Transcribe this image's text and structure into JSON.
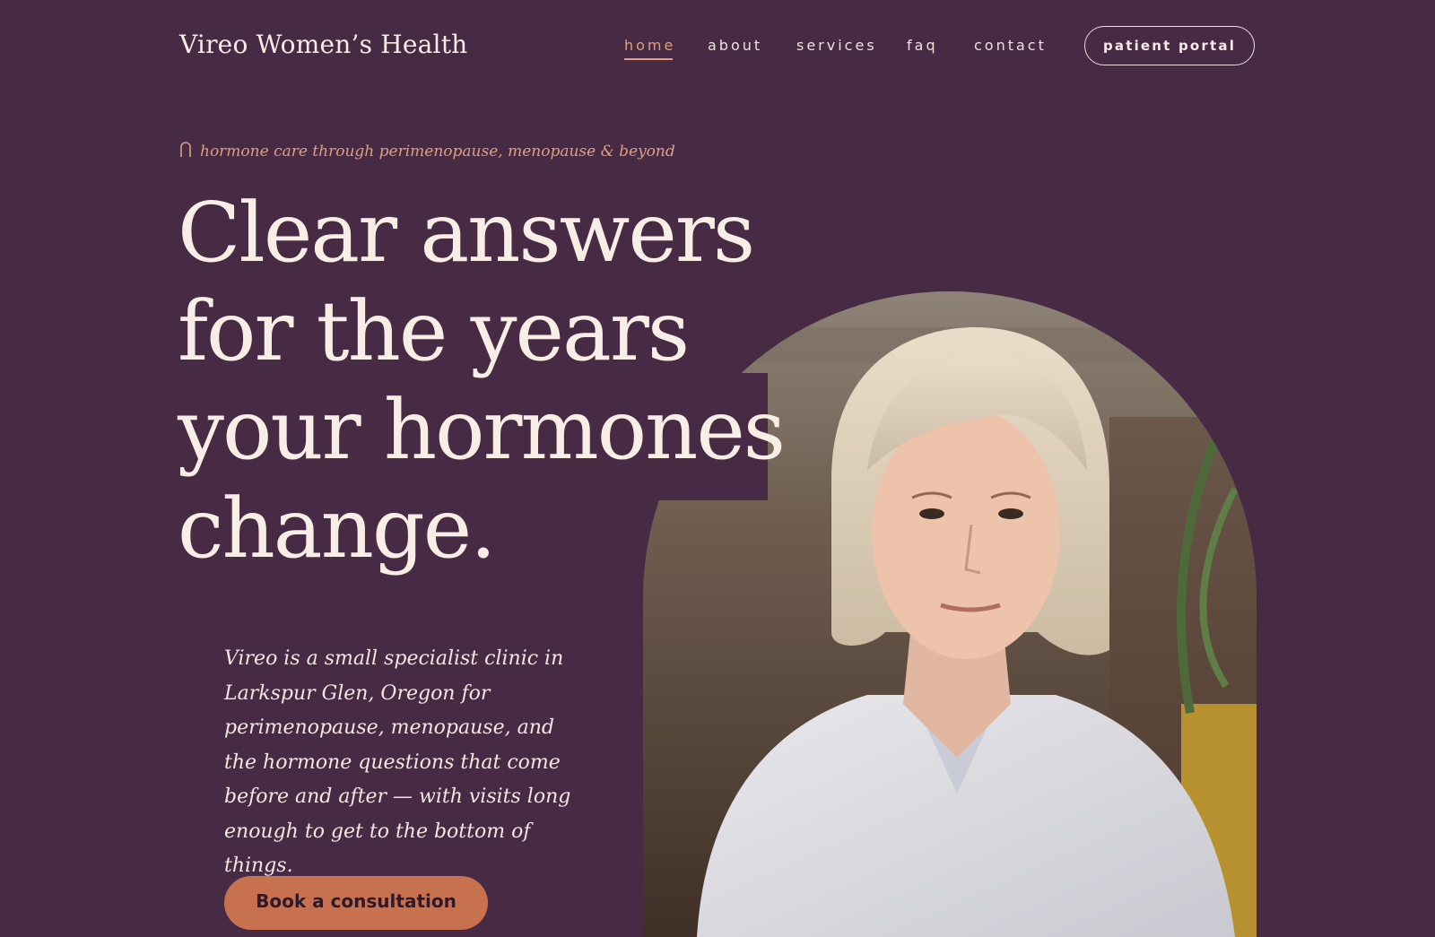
{
  "header": {
    "logo": "Vireo Women’s Health",
    "nav": [
      {
        "label": "home",
        "active": true
      },
      {
        "label": "about",
        "active": false
      },
      {
        "label": "services",
        "active": false
      },
      {
        "label": "faq",
        "active": false
      },
      {
        "label": "contact",
        "active": false
      }
    ],
    "portal_label": "patient portal"
  },
  "hero": {
    "eyebrow_icon": "arch-icon",
    "eyebrow": "hormone care through perimenopause, menopause & beyond",
    "headline_lines": [
      "Clear answers",
      "for the years",
      "your hormones",
      "change."
    ],
    "lede": "Vireo is a small specialist clinic in Larkspur Glen, Oregon for perimenopause, menopause, and the hormone questions that come before and after — with visits long enough to get to the bottom of things.",
    "cta_label": "Book a consultation",
    "photo": "portrait of a woman with short platinum blonde hair wearing a white collared shirt"
  },
  "colors": {
    "background": "#472a44",
    "accent": "#e0a07f",
    "cta": "#c8714f",
    "text": "#f9eee6"
  }
}
